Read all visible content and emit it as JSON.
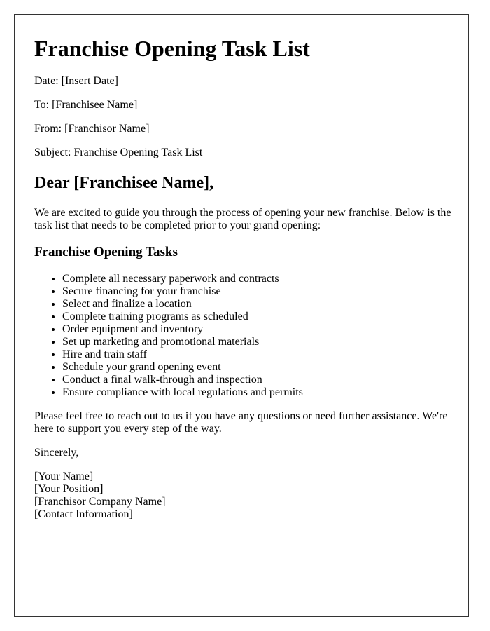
{
  "document": {
    "title": "Franchise Opening Task List",
    "meta": {
      "date": "Date: [Insert Date]",
      "to": "To: [Franchisee Name]",
      "from": "From: [Franchisor Name]",
      "subject": "Subject: Franchise Opening Task List"
    },
    "salutation": "Dear [Franchisee Name],",
    "intro": "We are excited to guide you through the process of opening your new franchise. Below is the task list that needs to be completed prior to your grand opening:",
    "tasks_heading": "Franchise Opening Tasks",
    "tasks": [
      "Complete all necessary paperwork and contracts",
      "Secure financing for your franchise",
      "Select and finalize a location",
      "Complete training programs as scheduled",
      "Order equipment and inventory",
      "Set up marketing and promotional materials",
      "Hire and train staff",
      "Schedule your grand opening event",
      "Conduct a final walk-through and inspection",
      "Ensure compliance with local regulations and permits"
    ],
    "closing_paragraph": "Please feel free to reach out to us if you have any questions or need further assistance. We're here to support you every step of the way.",
    "sign_off": "Sincerely,",
    "signature": {
      "name": "[Your Name]",
      "position": "[Your Position]",
      "company": "[Franchisor Company Name]",
      "contact": "[Contact Information]"
    }
  }
}
